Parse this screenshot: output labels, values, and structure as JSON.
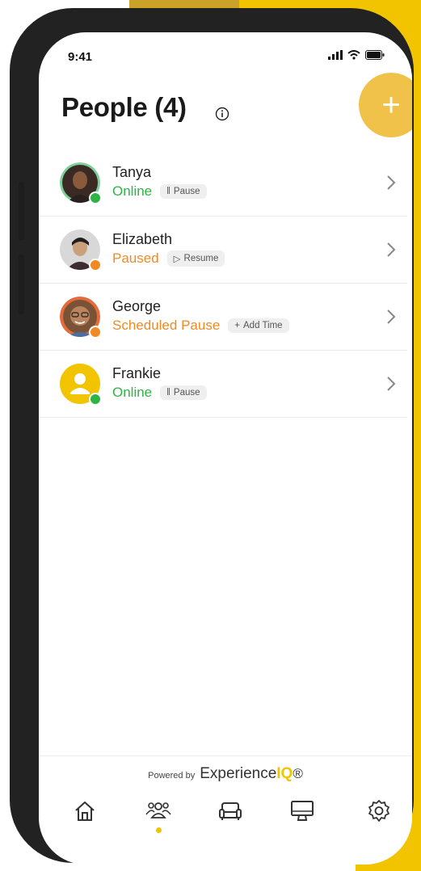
{
  "status_bar": {
    "time": "9:41"
  },
  "header": {
    "title": "People (4)"
  },
  "people": [
    {
      "name": "Tanya",
      "status": "Online",
      "status_color": "#2fb344",
      "action": "Pause",
      "action_prefix": "‖"
    },
    {
      "name": "Elizabeth",
      "status": "Paused",
      "status_color": "#f08a24",
      "action": "Resume",
      "action_prefix": "▷"
    },
    {
      "name": "George",
      "status": "Scheduled Pause",
      "status_color": "#f08a24",
      "action": "Add Time",
      "action_prefix": "+"
    },
    {
      "name": "Frankie",
      "status": "Online",
      "status_color": "#2fb344",
      "action": "Pause",
      "action_prefix": "‖"
    }
  ],
  "footer": {
    "powered_by": "Powered by",
    "brand_part1": "Experience",
    "brand_part2": "IQ",
    "brand_reg": "®"
  },
  "colors": {
    "accent": "#f2c400",
    "add_button": "#f1c24a",
    "online": "#2fb344",
    "paused": "#f08a24"
  },
  "tabs": [
    {
      "icon": "home-icon",
      "active": false
    },
    {
      "icon": "people-icon",
      "active": true
    },
    {
      "icon": "couch-icon",
      "active": false
    },
    {
      "icon": "monitor-icon",
      "active": false
    },
    {
      "icon": "gear-icon",
      "active": false
    }
  ]
}
